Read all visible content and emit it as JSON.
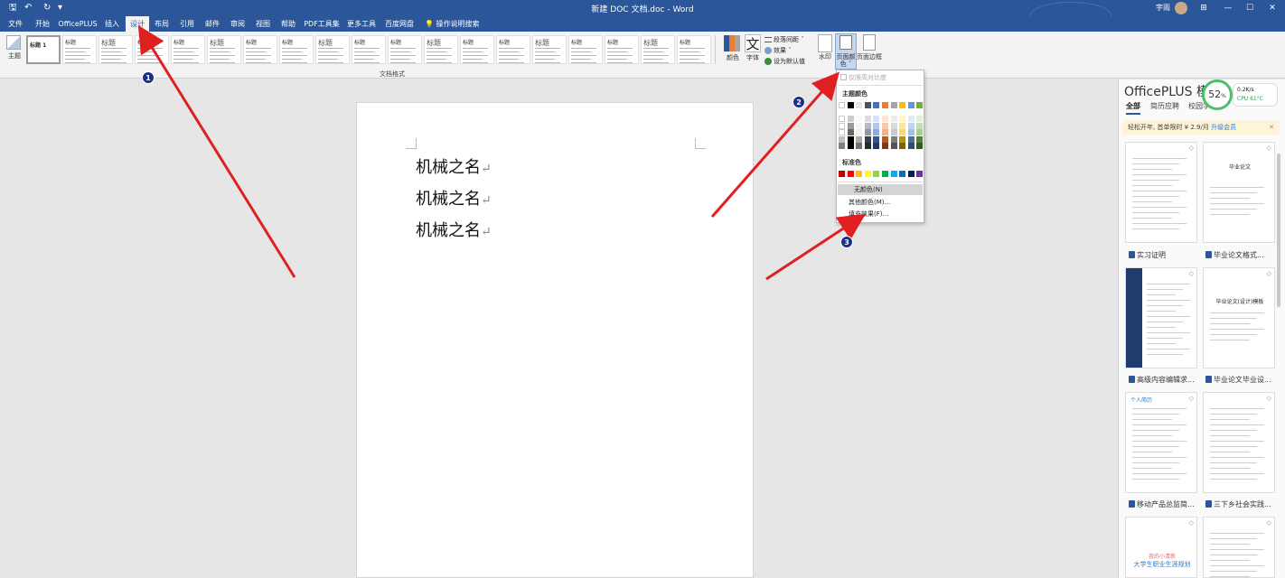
{
  "titlebar": {
    "title": "新建 DOC 文档.doc - Word",
    "user": "宇雨",
    "qa_save": "🖫",
    "qa_undo": "↶",
    "qa_redo": "↻",
    "qa_more": "▾",
    "win_share": "⊞",
    "win_min": "—",
    "win_max": "☐",
    "win_close": "✕"
  },
  "menu": {
    "tabs": [
      "文件",
      "开始",
      "OfficePLUS",
      "插入",
      "设计",
      "布局",
      "引用",
      "邮件",
      "审阅",
      "视图",
      "帮助",
      "PDF工具集",
      "更多工具",
      "百度网盘"
    ],
    "active": "设计",
    "search": "操作说明搜索"
  },
  "ribbon": {
    "theme_label": "主题",
    "style_heading": "标题",
    "first_style_title": "标题 1",
    "group_label": "文档格式",
    "colors_label": "颜色",
    "fonts_label": "字体",
    "fonts_glyph": "文",
    "para_spacing": "段落间距 ˇ",
    "effects": "效果 ˇ",
    "set_default": "设为默认值",
    "watermark": "水印",
    "page_color_line1": "页面颜",
    "page_color_line2": "色 ˇ",
    "page_borders": "页面边框"
  },
  "document": {
    "lines": [
      "机械之名",
      "机械之名",
      "机械之名"
    ],
    "para_mark": "↵"
  },
  "dropdown": {
    "checkbox": "仅限高对比度",
    "theme_colors": "主题颜色",
    "standard_colors": "标准色",
    "no_color": "无颜色(N)",
    "more_colors": "其他颜色(M)...",
    "fill_effects": "填充效果(F)...",
    "theme_top": [
      "#ffffff",
      "#000000",
      "#e7e6e6",
      "#44546a",
      "#4472c4",
      "#ed7d31",
      "#a5a5a5",
      "#ffc000",
      "#5b9bd5",
      "#70ad47"
    ],
    "standard": [
      "#c00000",
      "#ff0000",
      "#ffc000",
      "#ffff00",
      "#92d050",
      "#00b050",
      "#00b0f0",
      "#0070c0",
      "#002060",
      "#7030a0"
    ]
  },
  "panel": {
    "title": "OfficePLUS 模板",
    "close": "✕",
    "tabs": [
      "全部",
      "简历应聘",
      "校园学"
    ],
    "promo_text": "轻松开年, 首单限时 ¥ 2.9/月 ",
    "promo_link": "升级会员",
    "promo_close": "✕",
    "cards": [
      "实习证明",
      "毕业论文格式...",
      "高级内容编辑求...",
      "毕业论文毕业设...",
      "移动产品总监简...",
      "三下乡社会实践...",
      "",
      ""
    ],
    "card_texts": {
      "thesis": "毕业论文",
      "thesis2": "毕业论文(设计)模板",
      "resume": "个人简历",
      "career": "大学生职业生涯规划",
      "career_top": "我的小清新"
    }
  },
  "perf": {
    "percent": "52",
    "percent_unit": "%",
    "net": "0.2K/s",
    "cpu": "CPU 61°C"
  },
  "annotations": {
    "badges": [
      "1",
      "2",
      "3"
    ],
    "arrow_color": "#e02020"
  }
}
